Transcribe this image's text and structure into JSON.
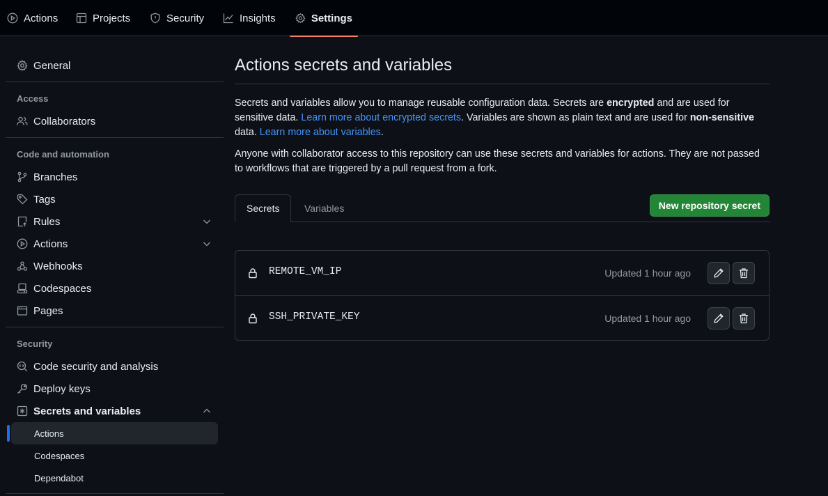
{
  "topnav": {
    "tabs": [
      {
        "label": "Actions",
        "icon": "play-icon"
      },
      {
        "label": "Projects",
        "icon": "table-icon"
      },
      {
        "label": "Security",
        "icon": "shield-icon"
      },
      {
        "label": "Insights",
        "icon": "graph-icon"
      },
      {
        "label": "Settings",
        "icon": "gear-icon",
        "active": true
      }
    ],
    "active_underline_color": "#f78166"
  },
  "sidebar": {
    "general": "General",
    "sections": {
      "access": {
        "heading": "Access",
        "items": [
          "Collaborators"
        ]
      },
      "code": {
        "heading": "Code and automation",
        "items": [
          "Branches",
          "Tags",
          "Rules",
          "Actions",
          "Webhooks",
          "Codespaces",
          "Pages"
        ]
      },
      "security": {
        "heading": "Security",
        "items": [
          "Code security and analysis",
          "Deploy keys",
          "Secrets and variables"
        ]
      }
    },
    "subitems": [
      "Actions",
      "Codespaces",
      "Dependabot"
    ],
    "selected_subitem": "Actions",
    "selection_color": "#1f6feb"
  },
  "main": {
    "title": "Actions secrets and variables",
    "intro": {
      "t1": "Secrets and variables allow you to manage reusable configuration data. Secrets are ",
      "b1": "encrypted",
      "t2": " and are used for sensitive data. ",
      "link1": "Learn more about encrypted secrets",
      "t3": ". Variables are shown as plain text and are used for ",
      "b2": "non-sensitive",
      "t4": " data. ",
      "link2": "Learn more about variables",
      "t5": "."
    },
    "note": "Anyone with collaborator access to this repository can use these secrets and variables for actions. They are not passed to workflows that are triggered by a pull request from a fork.",
    "tabs": [
      "Secrets",
      "Variables"
    ],
    "active_tab": "Secrets",
    "new_button": "New repository secret",
    "secrets": [
      {
        "name": "REMOTE_VM_IP",
        "updated": "Updated 1 hour ago"
      },
      {
        "name": "SSH_PRIVATE_KEY",
        "updated": "Updated 1 hour ago"
      }
    ],
    "link_color": "#4493f8",
    "button_color": "#238636"
  }
}
